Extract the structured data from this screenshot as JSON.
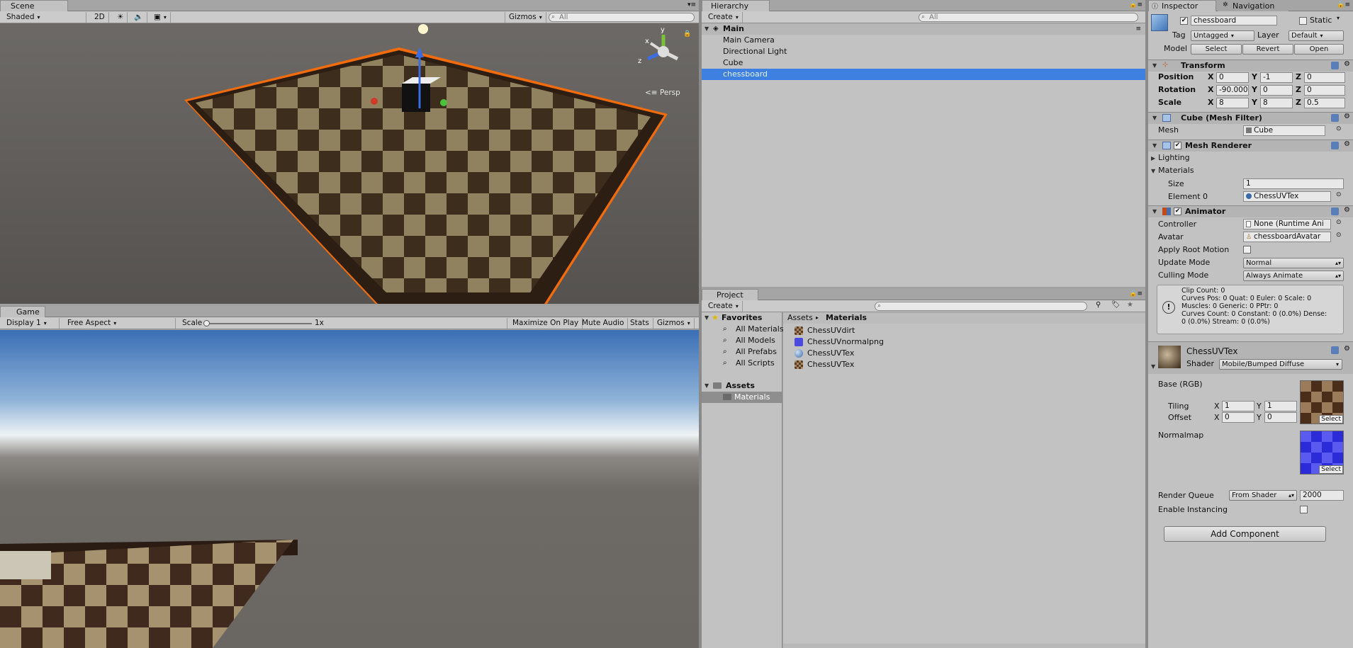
{
  "scene": {
    "tab": "Scene",
    "shading": "Shaded",
    "mode_2d": "2D",
    "gizmos": "Gizmos",
    "search_placeholder": "All",
    "persp": "Persp",
    "axes": {
      "y": "y",
      "x": "x",
      "z": "z"
    }
  },
  "game": {
    "tab": "Game",
    "display": "Display 1",
    "aspect": "Free Aspect",
    "scale_label": "Scale",
    "scale_value": "1x",
    "maximize": "Maximize On Play",
    "mute": "Mute Audio",
    "stats": "Stats",
    "gizmos": "Gizmos"
  },
  "hierarchy": {
    "tab": "Hierarchy",
    "create": "Create",
    "search_placeholder": "All",
    "scene_name": "Main",
    "items": [
      "Main Camera",
      "Directional Light",
      "Cube",
      "chessboard"
    ],
    "selected_index": 3
  },
  "project": {
    "tab": "Project",
    "create": "Create",
    "favorites": "Favorites",
    "favorite_items": [
      "All Materials",
      "All Models",
      "All Prefabs",
      "All Scripts"
    ],
    "assets": "Assets",
    "materials_folder": "Materials",
    "breadcrumb": [
      "Assets",
      "Materials"
    ],
    "files": [
      {
        "name": "ChessUVdirt",
        "icon": "texture-icon"
      },
      {
        "name": "ChessUVnormalpng",
        "icon": "normalmap-icon"
      },
      {
        "name": "ChessUVTex",
        "icon": "material-sphere-icon"
      },
      {
        "name": "ChessUVTex",
        "icon": "texture-icon"
      }
    ]
  },
  "inspector": {
    "tab": "Inspector",
    "nav_tab": "Navigation",
    "object_name": "chessboard",
    "static_label": "Static",
    "tag_label": "Tag",
    "tag_value": "Untagged",
    "layer_label": "Layer",
    "layer_value": "Default",
    "model_label": "Model",
    "model_buttons": [
      "Select",
      "Revert",
      "Open"
    ],
    "transform": {
      "title": "Transform",
      "position_label": "Position",
      "rotation_label": "Rotation",
      "scale_label": "Scale",
      "position": {
        "x": "0",
        "y": "-1",
        "z": "0"
      },
      "rotation": {
        "x": "-90.000",
        "y": "0",
        "z": "0"
      },
      "scale": {
        "x": "8",
        "y": "8",
        "z": "0.5"
      }
    },
    "mesh_filter": {
      "title": "Cube (Mesh Filter)",
      "mesh_label": "Mesh",
      "mesh_value": "Cube"
    },
    "mesh_renderer": {
      "title": "Mesh Renderer",
      "lighting": "Lighting",
      "materials": "Materials",
      "size_label": "Size",
      "size_value": "1",
      "element_label": "Element 0",
      "element_value": "ChessUVTex"
    },
    "animator": {
      "title": "Animator",
      "controller_label": "Controller",
      "controller_value": "None (Runtime Ani",
      "avatar_label": "Avatar",
      "avatar_value": "chessboardAvatar",
      "root_motion_label": "Apply Root Motion",
      "update_label": "Update Mode",
      "update_value": "Normal",
      "culling_label": "Culling Mode",
      "culling_value": "Always Animate",
      "info": [
        "Clip Count: 0",
        "Curves Pos: 0 Quat: 0 Euler: 0 Scale: 0",
        "Muscles: 0 Generic: 0 PPtr: 0",
        "Curves Count: 0 Constant: 0 (0.0%) Dense:",
        "0 (0.0%) Stream: 0 (0.0%)"
      ]
    },
    "material": {
      "name": "ChessUVTex",
      "shader_label": "Shader",
      "shader_value": "Mobile/Bumped Diffuse",
      "base_label": "Base (RGB)",
      "tiling_label": "Tiling",
      "offset_label": "Offset",
      "tiling": {
        "x": "1",
        "y": "1"
      },
      "offset": {
        "x": "0",
        "y": "0"
      },
      "normalmap_label": "Normalmap",
      "select": "Select",
      "render_queue_label": "Render Queue",
      "render_queue_mode": "From Shader",
      "render_queue_value": "2000",
      "instancing_label": "Enable Instancing"
    },
    "add_component": "Add Component"
  },
  "colors": {
    "selection": "#3d80df",
    "outline": "#f26c0c",
    "sky_top": "#3a6fb5",
    "ground": "#6e6a66"
  }
}
